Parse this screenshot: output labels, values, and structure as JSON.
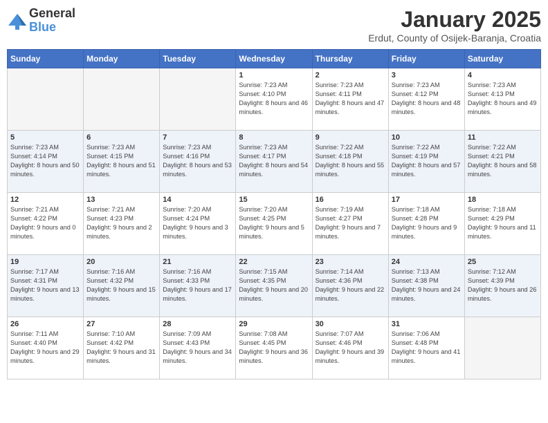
{
  "logo": {
    "general": "General",
    "blue": "Blue"
  },
  "title": "January 2025",
  "location": "Erdut, County of Osijek-Baranja, Croatia",
  "weekdays": [
    "Sunday",
    "Monday",
    "Tuesday",
    "Wednesday",
    "Thursday",
    "Friday",
    "Saturday"
  ],
  "weeks": [
    [
      {
        "day": "",
        "info": ""
      },
      {
        "day": "",
        "info": ""
      },
      {
        "day": "",
        "info": ""
      },
      {
        "day": "1",
        "info": "Sunrise: 7:23 AM\nSunset: 4:10 PM\nDaylight: 8 hours and 46 minutes."
      },
      {
        "day": "2",
        "info": "Sunrise: 7:23 AM\nSunset: 4:11 PM\nDaylight: 8 hours and 47 minutes."
      },
      {
        "day": "3",
        "info": "Sunrise: 7:23 AM\nSunset: 4:12 PM\nDaylight: 8 hours and 48 minutes."
      },
      {
        "day": "4",
        "info": "Sunrise: 7:23 AM\nSunset: 4:13 PM\nDaylight: 8 hours and 49 minutes."
      }
    ],
    [
      {
        "day": "5",
        "info": "Sunrise: 7:23 AM\nSunset: 4:14 PM\nDaylight: 8 hours and 50 minutes."
      },
      {
        "day": "6",
        "info": "Sunrise: 7:23 AM\nSunset: 4:15 PM\nDaylight: 8 hours and 51 minutes."
      },
      {
        "day": "7",
        "info": "Sunrise: 7:23 AM\nSunset: 4:16 PM\nDaylight: 8 hours and 53 minutes."
      },
      {
        "day": "8",
        "info": "Sunrise: 7:23 AM\nSunset: 4:17 PM\nDaylight: 8 hours and 54 minutes."
      },
      {
        "day": "9",
        "info": "Sunrise: 7:22 AM\nSunset: 4:18 PM\nDaylight: 8 hours and 55 minutes."
      },
      {
        "day": "10",
        "info": "Sunrise: 7:22 AM\nSunset: 4:19 PM\nDaylight: 8 hours and 57 minutes."
      },
      {
        "day": "11",
        "info": "Sunrise: 7:22 AM\nSunset: 4:21 PM\nDaylight: 8 hours and 58 minutes."
      }
    ],
    [
      {
        "day": "12",
        "info": "Sunrise: 7:21 AM\nSunset: 4:22 PM\nDaylight: 9 hours and 0 minutes."
      },
      {
        "day": "13",
        "info": "Sunrise: 7:21 AM\nSunset: 4:23 PM\nDaylight: 9 hours and 2 minutes."
      },
      {
        "day": "14",
        "info": "Sunrise: 7:20 AM\nSunset: 4:24 PM\nDaylight: 9 hours and 3 minutes."
      },
      {
        "day": "15",
        "info": "Sunrise: 7:20 AM\nSunset: 4:25 PM\nDaylight: 9 hours and 5 minutes."
      },
      {
        "day": "16",
        "info": "Sunrise: 7:19 AM\nSunset: 4:27 PM\nDaylight: 9 hours and 7 minutes."
      },
      {
        "day": "17",
        "info": "Sunrise: 7:18 AM\nSunset: 4:28 PM\nDaylight: 9 hours and 9 minutes."
      },
      {
        "day": "18",
        "info": "Sunrise: 7:18 AM\nSunset: 4:29 PM\nDaylight: 9 hours and 11 minutes."
      }
    ],
    [
      {
        "day": "19",
        "info": "Sunrise: 7:17 AM\nSunset: 4:31 PM\nDaylight: 9 hours and 13 minutes."
      },
      {
        "day": "20",
        "info": "Sunrise: 7:16 AM\nSunset: 4:32 PM\nDaylight: 9 hours and 15 minutes."
      },
      {
        "day": "21",
        "info": "Sunrise: 7:16 AM\nSunset: 4:33 PM\nDaylight: 9 hours and 17 minutes."
      },
      {
        "day": "22",
        "info": "Sunrise: 7:15 AM\nSunset: 4:35 PM\nDaylight: 9 hours and 20 minutes."
      },
      {
        "day": "23",
        "info": "Sunrise: 7:14 AM\nSunset: 4:36 PM\nDaylight: 9 hours and 22 minutes."
      },
      {
        "day": "24",
        "info": "Sunrise: 7:13 AM\nSunset: 4:38 PM\nDaylight: 9 hours and 24 minutes."
      },
      {
        "day": "25",
        "info": "Sunrise: 7:12 AM\nSunset: 4:39 PM\nDaylight: 9 hours and 26 minutes."
      }
    ],
    [
      {
        "day": "26",
        "info": "Sunrise: 7:11 AM\nSunset: 4:40 PM\nDaylight: 9 hours and 29 minutes."
      },
      {
        "day": "27",
        "info": "Sunrise: 7:10 AM\nSunset: 4:42 PM\nDaylight: 9 hours and 31 minutes."
      },
      {
        "day": "28",
        "info": "Sunrise: 7:09 AM\nSunset: 4:43 PM\nDaylight: 9 hours and 34 minutes."
      },
      {
        "day": "29",
        "info": "Sunrise: 7:08 AM\nSunset: 4:45 PM\nDaylight: 9 hours and 36 minutes."
      },
      {
        "day": "30",
        "info": "Sunrise: 7:07 AM\nSunset: 4:46 PM\nDaylight: 9 hours and 39 minutes."
      },
      {
        "day": "31",
        "info": "Sunrise: 7:06 AM\nSunset: 4:48 PM\nDaylight: 9 hours and 41 minutes."
      },
      {
        "day": "",
        "info": ""
      }
    ]
  ]
}
